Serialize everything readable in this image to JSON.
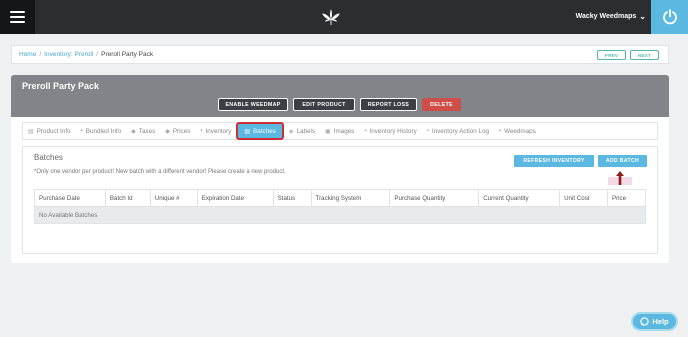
{
  "topbar": {
    "user_name": "Wacky Weedmaps",
    "chevron": "⌄"
  },
  "breadcrumb": {
    "items": [
      "Home",
      "Inventory: Preroll",
      "Preroll Party Pack"
    ],
    "separator": "/"
  },
  "pager": {
    "prev": "PREV",
    "next": "NEXT"
  },
  "product": {
    "title": "Preroll Party Pack",
    "actions": [
      "ENABLE WEEDMAP",
      "EDIT PRODUCT",
      "REPORT LOSS",
      "DELETE"
    ]
  },
  "tabs": [
    {
      "label": "Product Info",
      "icon": "document-icon"
    },
    {
      "label": "Bundled Info",
      "icon": "lock-icon"
    },
    {
      "label": "Taxes",
      "icon": "tax-icon"
    },
    {
      "label": "Prices",
      "icon": "price-icon"
    },
    {
      "label": "Inventory",
      "icon": "lock-icon"
    },
    {
      "label": "Batches",
      "icon": "batches-icon",
      "active": true
    },
    {
      "label": "Labels",
      "icon": "tag-icon"
    },
    {
      "label": "Images",
      "icon": "image-icon"
    },
    {
      "label": "Inventory History",
      "icon": "lock-icon"
    },
    {
      "label": "Inventory Action Log",
      "icon": "lock-icon"
    },
    {
      "label": "Weedmaps",
      "icon": "lock-icon"
    }
  ],
  "batches": {
    "title": "Batches",
    "note": "*Only one vendor per product! New batch with a different vendor! Please create a new product.",
    "refresh_label": "REFRESH INVENTORY",
    "add_label": "ADD BATCH",
    "columns": [
      "Purchase Date",
      "Batch Id",
      "Unique #",
      "Expiration Date",
      "Status",
      "Tracking System",
      "Purchase Quantity",
      "Current Quantity",
      "Unit Cost",
      "Price"
    ],
    "empty_text": "No Available Batches"
  },
  "help": {
    "label": "Help"
  },
  "colors": {
    "accent": "#5bb8e0",
    "danger": "#cf4e47",
    "header_gray": "#818589",
    "topbar": "#2b2e31"
  }
}
